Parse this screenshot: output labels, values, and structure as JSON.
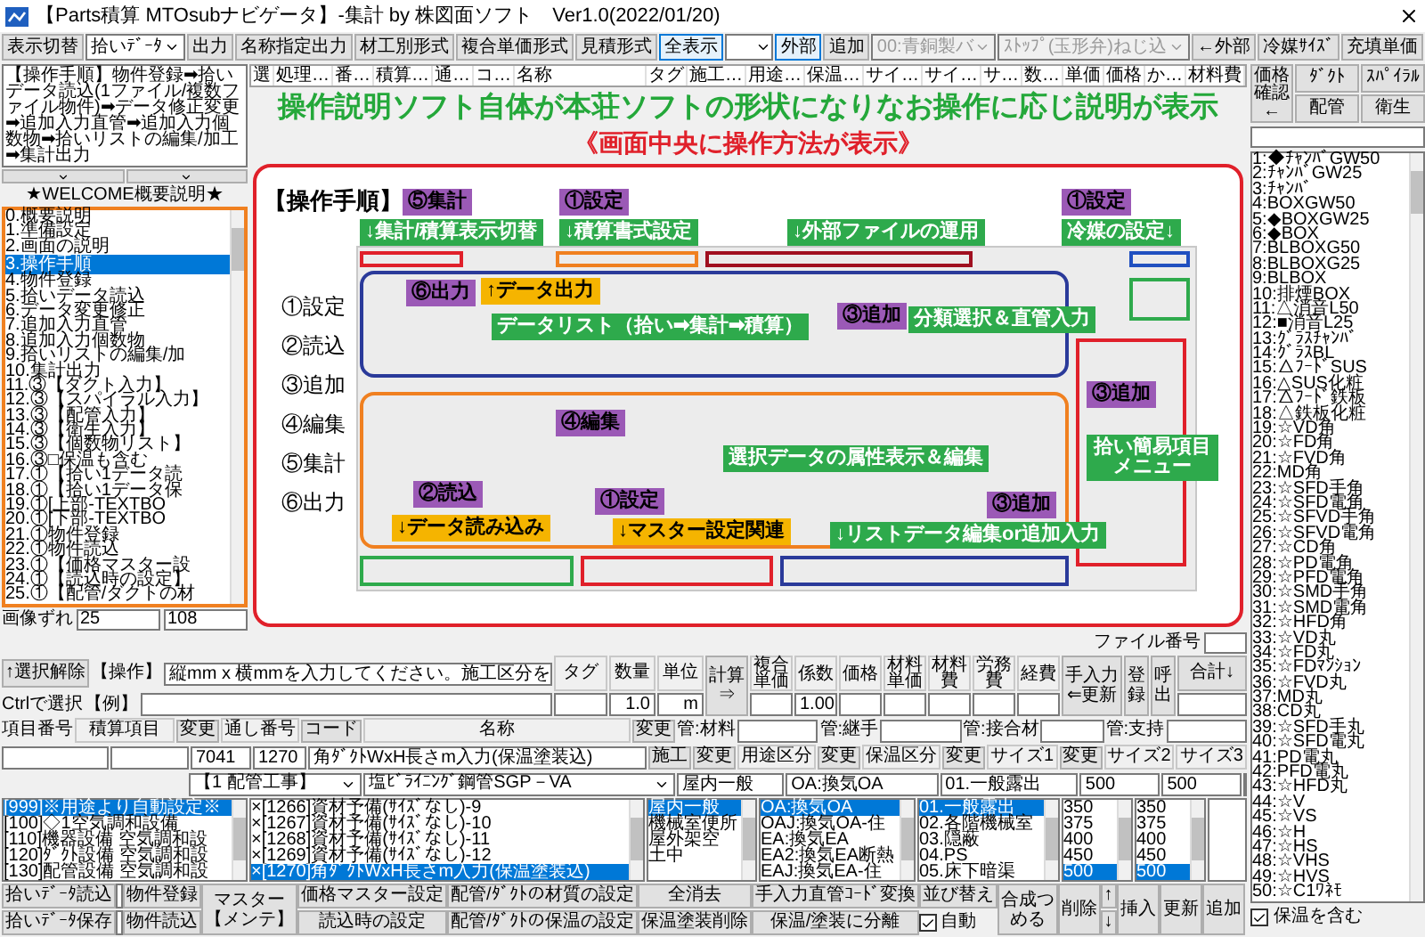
{
  "window": {
    "title": "【Parts積算 MTOsubナビゲータ】-集計 by 株図面ソフト　Ver1.0(2022/01/20)"
  },
  "toolbar": [
    {
      "kind": "button",
      "label": "表示切替",
      "selected": false
    },
    {
      "kind": "select",
      "value": "拾いﾃﾞｰﾀ",
      "disabled": false
    },
    {
      "kind": "button",
      "label": "出力",
      "selected": false
    },
    {
      "kind": "button",
      "label": "名称指定出力",
      "selected": false
    },
    {
      "kind": "button",
      "label": "材工別形式",
      "selected": false
    },
    {
      "kind": "button",
      "label": "複合単価形式",
      "selected": false
    },
    {
      "kind": "button",
      "label": "見積形式",
      "selected": false
    },
    {
      "kind": "button",
      "label": "全表示",
      "selected": true
    },
    {
      "kind": "combo",
      "disabled": false
    },
    {
      "kind": "button",
      "label": "外部",
      "selected": true
    },
    {
      "kind": "button",
      "label": "追加",
      "selected": false
    },
    {
      "kind": "select",
      "value": "00:青銅製バ",
      "disabled": true
    },
    {
      "kind": "select",
      "value": "ｽﾄｯﾌﾟ(玉形弁)ねじ込",
      "disabled": true
    },
    {
      "kind": "button",
      "label": "←外部",
      "selected": false
    },
    {
      "kind": "button",
      "label": "冷媒ｻｲｽﾞ",
      "selected": false
    },
    {
      "kind": "button",
      "label": "充填単価",
      "selected": false
    }
  ],
  "left_panel": {
    "procedure_text": "【操作手順】物件登録➡拾いデータ読込(1ファイル/複数ファイル物件)➡データ修正変更➡追加入力直管➡追加入力個数物➡拾いリストの編集/加工➡集計出力",
    "welcome": "★WELCOME概要説明★",
    "items": [
      {
        "label": "0.概要説明",
        "selected": false
      },
      {
        "label": "1.準備設定",
        "selected": false
      },
      {
        "label": "2.画面の説明",
        "selected": false
      },
      {
        "label": "3.操作手順",
        "selected": true
      },
      {
        "label": "4.物件登録",
        "selected": false
      },
      {
        "label": "5.拾いデータ読込",
        "selected": false
      },
      {
        "label": "6.データ変更修正",
        "selected": false
      },
      {
        "label": "7.追加入力直管",
        "selected": false
      },
      {
        "label": "8.追加入力個数物",
        "selected": false
      },
      {
        "label": "9.拾いリストの編集/加",
        "selected": false
      },
      {
        "label": "10.集計出力",
        "selected": false
      },
      {
        "label": "11.③【ダクト入力】",
        "selected": false
      },
      {
        "label": "12.③【スパイラル入力】",
        "selected": false
      },
      {
        "label": "13.③【配管入力】",
        "selected": false
      },
      {
        "label": "14.③【衛生入力】",
        "selected": false
      },
      {
        "label": "15.③【個数物リスト】",
        "selected": false
      },
      {
        "label": "16.③□保温も含む",
        "selected": false
      },
      {
        "label": "17.①【拾い1データ読",
        "selected": false
      },
      {
        "label": "18.①【拾い1データ保",
        "selected": false
      },
      {
        "label": "19.①[上部-TEXTBO",
        "selected": false
      },
      {
        "label": "20.①[下部-TEXTBO",
        "selected": false
      },
      {
        "label": "21.①物件登録",
        "selected": false
      },
      {
        "label": "22.①物件読込",
        "selected": false
      },
      {
        "label": "23.①【価格マスター設",
        "selected": false
      },
      {
        "label": "24.①【読込時の設定】",
        "selected": false
      },
      {
        "label": "25.①【配管/ダクトの材",
        "selected": false
      }
    ],
    "offset_label": "画像ずれ",
    "offset_values": [
      "25",
      "108"
    ]
  },
  "grid_header": [
    "選",
    "処理…",
    "番…",
    "積算…",
    "通…",
    "コ…",
    "名称",
    "タグ",
    "施工…",
    "用途…",
    "保温…",
    "サイ…",
    "サイ…",
    "サ…",
    "数…",
    "単価",
    "価格",
    "か…",
    "材料費"
  ],
  "captions": {
    "headline": "操作説明ソフト自体が本荘ソフトの形状になりなお操作に応じ説明が表示",
    "subline": "《画面中央に操作方法が表示》"
  },
  "tutorial": {
    "title": "【操作手順】",
    "steps": [
      "①設定",
      "②読込",
      "③追加",
      "④編集",
      "⑤集計",
      "⑥出力"
    ],
    "annotations": [
      {
        "kind": "step",
        "text": "⑤集計"
      },
      {
        "kind": "step",
        "text": "①設定"
      },
      {
        "kind": "step",
        "text": "①設定"
      },
      {
        "kind": "note",
        "text": "↓集計/積算表示切替"
      },
      {
        "kind": "note",
        "text": "↓積算書式設定"
      },
      {
        "kind": "note",
        "text": "↓外部ファイルの運用"
      },
      {
        "kind": "note",
        "text": "冷媒の設定↓"
      },
      {
        "kind": "step",
        "text": "⑥出力"
      },
      {
        "kind": "hint",
        "text": "↑データ出力"
      },
      {
        "kind": "note",
        "text": "データリスト（拾い➡集計➡積算）"
      },
      {
        "kind": "step",
        "text": "③追加"
      },
      {
        "kind": "note",
        "text": "分類選択＆直管入力"
      },
      {
        "kind": "step",
        "text": "③追加"
      },
      {
        "kind": "step",
        "text": "④編集"
      },
      {
        "kind": "note",
        "text": "選択データの属性表示＆編集"
      },
      {
        "kind": "note",
        "text": "拾い簡易項目メニュー"
      },
      {
        "kind": "step",
        "text": "②読込"
      },
      {
        "kind": "hint",
        "text": "↓データ読み込み"
      },
      {
        "kind": "step",
        "text": "①設定"
      },
      {
        "kind": "hint",
        "text": "↓マスター設定関連"
      },
      {
        "kind": "step",
        "text": "③追加"
      },
      {
        "kind": "note",
        "text": "↓リストデータ編集or追加入力"
      }
    ]
  },
  "right_panel": {
    "price_button": "価格確認←",
    "buttons": [
      "ﾀﾞｸﾄ",
      "ｽﾊﾟｲﾗﾙ",
      "配管",
      "衛生"
    ],
    "items": [
      "1:◆ﾁｬﾝﾊﾞGW50",
      "2:ﾁｬﾝﾊﾞGW25",
      "3:ﾁｬﾝﾊﾞ",
      "4:BOXGW50",
      "5:◆BOXGW25",
      "6:◆BOX",
      "7:BLBOXG50",
      "8:BLBOXG25",
      "9:BLBOX",
      "10:排煙BOX",
      "11:△消音L50",
      "12:■消音L25",
      "13:ｸﾞﾗｽﾁｬﾝﾊﾞ",
      "14:ｸﾞﾗｽBL",
      "15:△ﾌｰﾄﾞSUS",
      "16:△SUS化粧",
      "17:△ﾌｰﾄﾞ鉄板",
      "18:△鉄板化粧",
      "19:☆VD角",
      "20:☆FD角",
      "21:☆FVD角",
      "22:MD角",
      "23:☆SFD手角",
      "24:☆SFD電角",
      "25:☆SFVD手角",
      "26:☆SFVD電角",
      "27:☆CD角",
      "28:☆PD電角",
      "29:☆PFD電角",
      "30:☆SMD手角",
      "31:☆SMD電角",
      "32:☆HFD角",
      "33:☆VD丸",
      "34:☆FD丸",
      "35:☆FDﾏﾝｼｮﾝ",
      "36:☆FVD丸",
      "37:MD丸",
      "38:CD丸",
      "39:☆SFD手丸",
      "40:☆SFD電丸",
      "41:PD電丸",
      "42:PFD電丸",
      "43:☆HFD丸",
      "44:☆V",
      "45:☆VS",
      "46:☆H",
      "47:☆HS",
      "48:☆VHS",
      "49:☆HVS",
      "50:☆C1ﾜﾈﾓ"
    ],
    "checkbox": {
      "label": "保温を含む",
      "checked": true
    }
  },
  "form": {
    "file_number_label": "ファイル番号",
    "deselect_button": "↑選択解除",
    "operation_label": "【操作】",
    "instruction": "縦mm x 横mmを入力してください。施工区分を",
    "ctrl_label": "Ctrlで選択",
    "example_label": "【例】",
    "entry_a": [
      {
        "header": "タグ"
      },
      {
        "header": "数量",
        "value": "1.0"
      },
      {
        "header": "単位",
        "value": "m"
      }
    ],
    "calc_button": "計算⇒",
    "entry_b": [
      {
        "header": "複合単価"
      },
      {
        "header": "係数",
        "value": "1.00"
      },
      {
        "header": "価格"
      },
      {
        "header": "材料単価"
      },
      {
        "header": "材料費"
      },
      {
        "header": "労務費"
      },
      {
        "header": "経費"
      }
    ],
    "side_buttons": [
      "手入力⇐更新",
      "登録",
      "呼出"
    ],
    "total_button": "合計↓",
    "item_label": "項目番号",
    "item_header": "積算項目",
    "change_button": "変更",
    "serial_label": "通し番号",
    "code_button": "コード",
    "name_header": "名称",
    "name_change_button": "変更",
    "pipe_labels": [
      "管:材料",
      "管:継手",
      "管:接合材",
      "管:支持"
    ],
    "serial": "7041",
    "code": "1270",
    "name": "角ﾀﾞｸﾄWxH長さm入力(保温塗装込)",
    "attributes": [
      {
        "kind": "button",
        "label": "施工"
      },
      {
        "kind": "button",
        "label": "変更"
      },
      {
        "kind": "header",
        "label": "用途区分"
      },
      {
        "kind": "button",
        "label": "変更"
      },
      {
        "kind": "header",
        "label": "保温区分"
      },
      {
        "kind": "button",
        "label": "変更"
      },
      {
        "kind": "header",
        "label": "サイズ1"
      },
      {
        "kind": "button",
        "label": "変更"
      },
      {
        "kind": "header",
        "label": "サイズ2"
      },
      {
        "kind": "header",
        "label": "サイズ3"
      }
    ],
    "work_select": "【1 配管工事】",
    "material_select": "塩ﾋﾞﾗｲﾆﾝｸﾞ鋼管SGP－VA",
    "values": [
      "屋内一般",
      "OA:換気OA",
      "01.一般露出",
      "500",
      "500"
    ],
    "lists": [
      [
        {
          "label": "[999]※用途より自動設定※",
          "selected": true
        },
        {
          "label": "[100]◇1空気調和設備",
          "selected": false
        },
        {
          "label": "[110]機器設備 空気調和設",
          "selected": false
        },
        {
          "label": "[120]ﾀﾞｸﾄ設備 空気調和設",
          "selected": false
        },
        {
          "label": "[130]配管設備 空気調和設",
          "selected": false
        }
      ],
      [
        {
          "label": "×[1266]資材予備(ｻｲｽﾞなし)-9",
          "selected": false
        },
        {
          "label": "×[1267]資材予備(ｻｲｽﾞなし)-10",
          "selected": false
        },
        {
          "label": "×[1268]資材予備(ｻｲｽﾞなし)-11",
          "selected": false
        },
        {
          "label": "×[1269]資材予備(ｻｲｽﾞなし)-12",
          "selected": false
        },
        {
          "label": "×[1270]角ﾀﾞｸﾄWxH長さm入力(保温塗装込)",
          "selected": true
        }
      ],
      [
        {
          "label": "屋内一般",
          "selected": true
        },
        {
          "label": "機械室便所",
          "selected": false
        },
        {
          "label": "屋外架空",
          "selected": false
        },
        {
          "label": "土中",
          "selected": false
        }
      ],
      [
        {
          "label": "OA:換気OA",
          "selected": true
        },
        {
          "label": "OAJ:換気OA-住",
          "selected": false
        },
        {
          "label": "EA:換気EA",
          "selected": false
        },
        {
          "label": "EA2:換気EA断熱",
          "selected": false
        },
        {
          "label": "EAJ:換気EA-住",
          "selected": false
        }
      ],
      [
        {
          "label": "01.一般露出",
          "selected": true
        },
        {
          "label": "02.各階機械室",
          "selected": false
        },
        {
          "label": "03.隠蔽",
          "selected": false
        },
        {
          "label": "04.PS",
          "selected": false
        },
        {
          "label": "05.床下暗渠",
          "selected": false
        }
      ],
      [
        {
          "label": "350",
          "selected": false
        },
        {
          "label": "375",
          "selected": false
        },
        {
          "label": "400",
          "selected": false
        },
        {
          "label": "450",
          "selected": false
        },
        {
          "label": "500",
          "selected": true
        }
      ],
      [
        {
          "label": "350",
          "selected": false
        },
        {
          "label": "375",
          "selected": false
        },
        {
          "label": "400",
          "selected": false
        },
        {
          "label": "450",
          "selected": false
        },
        {
          "label": "500",
          "selected": true
        }
      ]
    ],
    "actions": [
      {
        "kind": "pair",
        "top": "拾いﾃﾞｰﾀ読込",
        "bottom": "拾いﾃﾞｰﾀ保存"
      },
      {
        "kind": "fields"
      },
      {
        "kind": "pair",
        "top": "物件登録",
        "bottom": "物件読込"
      },
      {
        "kind": "tall",
        "label": "マスター【メンテ】"
      },
      {
        "kind": "pair",
        "top": "価格マスター設定",
        "bottom": "読込時の設定"
      },
      {
        "kind": "pair",
        "top": "配管/ﾀﾞｸﾄの材質の設定",
        "bottom": "配管/ﾀﾞｸﾄの保温の設定"
      },
      {
        "kind": "pair",
        "top": "全消去",
        "bottom": "保温塗装削除"
      },
      {
        "kind": "pair",
        "top": "手入力直管ｺｰﾄﾞ変換",
        "bottom": "保温/塗装に分離"
      },
      {
        "kind": "toggle",
        "top": "並び替え",
        "bottom": "自動",
        "checked": true
      },
      {
        "kind": "tall",
        "label": "合成つめる"
      },
      {
        "kind": "tall",
        "label": "削除"
      },
      {
        "kind": "pair",
        "top": "↑",
        "bottom": "↓"
      },
      {
        "kind": "tall",
        "label": "挿入"
      },
      {
        "kind": "tall",
        "label": "更新"
      },
      {
        "kind": "tall",
        "label": "追加"
      }
    ]
  }
}
